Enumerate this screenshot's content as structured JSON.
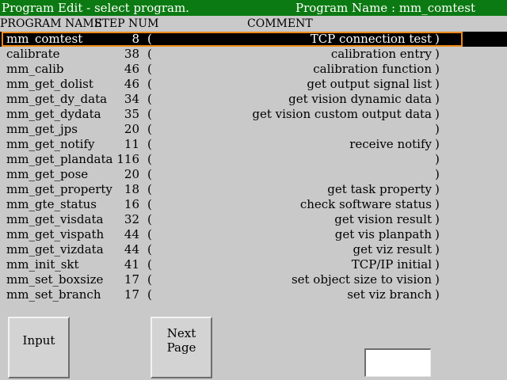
{
  "titlebar": {
    "left_text": "Program Edit - select program.",
    "right_text": "Program Name : mm_comtest"
  },
  "header": {
    "program_name": "PROGRAM NAME",
    "step_num": "STEP NUM",
    "comment": "COMMENT"
  },
  "programs": [
    {
      "name": "mm_comtest",
      "step": "8",
      "comment": "TCP connection test"
    },
    {
      "name": "calibrate",
      "step": "38",
      "comment": "calibration entry"
    },
    {
      "name": "mm_calib",
      "step": "46",
      "comment": "calibration function"
    },
    {
      "name": "mm_get_dolist",
      "step": "46",
      "comment": "get output signal list"
    },
    {
      "name": "mm_get_dy_data",
      "step": "34",
      "comment": "get vision dynamic data"
    },
    {
      "name": "mm_get_dydata",
      "step": "35",
      "comment": "get vision custom output data"
    },
    {
      "name": "mm_get_jps",
      "step": "20",
      "comment": ""
    },
    {
      "name": "mm_get_notify",
      "step": "11",
      "comment": "receive notify"
    },
    {
      "name": "mm_get_plandata",
      "step": "116",
      "comment": ""
    },
    {
      "name": "mm_get_pose",
      "step": "20",
      "comment": ""
    },
    {
      "name": "mm_get_property",
      "step": "18",
      "comment": "get task property"
    },
    {
      "name": "mm_gte_status",
      "step": "16",
      "comment": "check software status"
    },
    {
      "name": "mm_get_visdata",
      "step": "32",
      "comment": "get vision result"
    },
    {
      "name": "mm_get_vispath",
      "step": "44",
      "comment": "get vis planpath"
    },
    {
      "name": "mm_get_vizdata",
      "step": "44",
      "comment": "get viz result"
    },
    {
      "name": "mm_init_skt",
      "step": "41",
      "comment": "TCP/IP initial"
    },
    {
      "name": "mm_set_boxsize",
      "step": "17",
      "comment": "set object size to vision"
    },
    {
      "name": "mm_set_branch",
      "step": "17",
      "comment": "set viz branch"
    }
  ],
  "paren_open": "(",
  "paren_close": ")",
  "buttons": {
    "input_label": "Input",
    "next_page_label": "Next Page"
  },
  "input_box": {
    "value": ""
  },
  "colors": {
    "titlebar_bg": "#0b7a12",
    "background": "#c9c9c9",
    "selected_bg": "#000000",
    "selection_frame": "#f08a18"
  }
}
